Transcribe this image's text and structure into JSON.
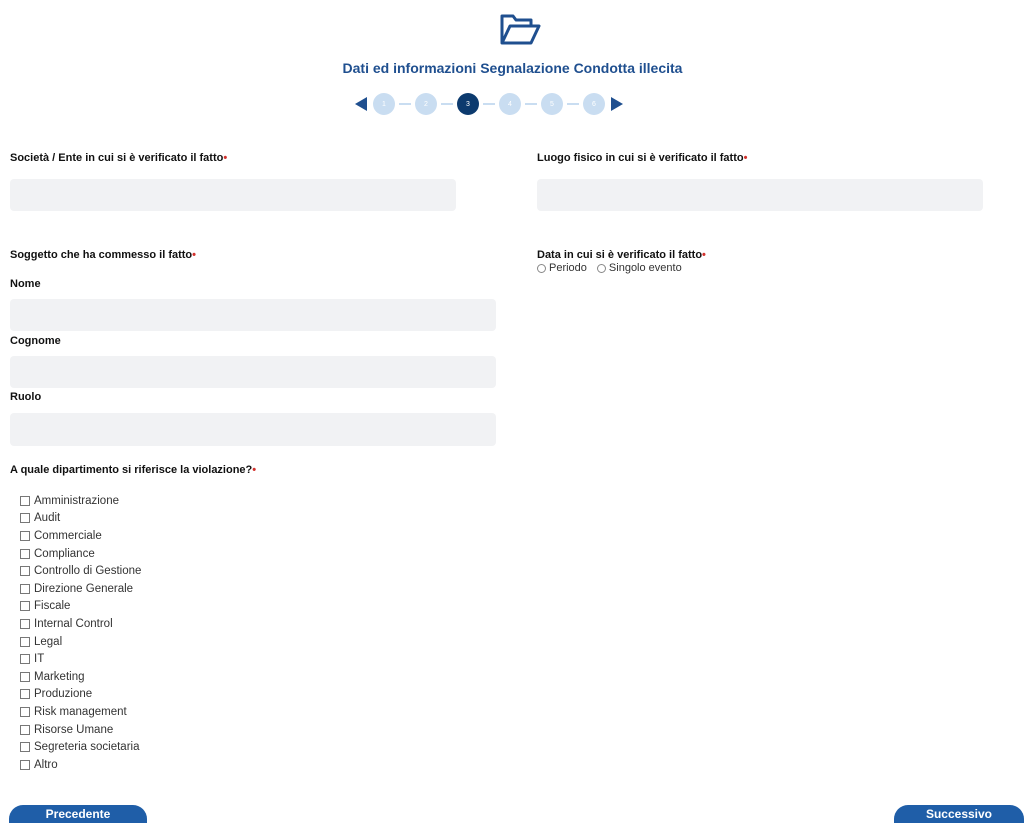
{
  "header": {
    "icon": "folder-open-icon",
    "title": "Dati ed informazioni Segnalazione Condotta illecita"
  },
  "stepper": {
    "steps": [
      "1",
      "2",
      "3",
      "4",
      "5",
      "6"
    ],
    "current": 3,
    "prev_icon": "arrow-left-icon",
    "next_icon": "arrow-right-icon"
  },
  "fields": {
    "societa": {
      "label": "Società / Ente in cui si è verificato il fatto",
      "value": ""
    },
    "luogo": {
      "label": "Luogo fisico in cui si è verificato il fatto",
      "value": ""
    },
    "soggetto": {
      "label": "Soggetto che ha commesso il fatto"
    },
    "nome": {
      "label": "Nome",
      "value": ""
    },
    "cognome": {
      "label": "Cognome",
      "value": ""
    },
    "ruolo": {
      "label": "Ruolo",
      "value": ""
    },
    "data": {
      "label": "Data in cui si è verificato il fatto",
      "options": [
        "Periodo",
        "Singolo evento"
      ]
    },
    "dipartimento": {
      "label": "A quale dipartimento si riferisce la violazione?",
      "options": [
        "Amministrazione",
        "Audit",
        "Commerciale",
        "Compliance",
        "Controllo di Gestione",
        "Direzione Generale",
        "Fiscale",
        "Internal Control",
        "Legal",
        "IT",
        "Marketing",
        "Produzione",
        "Risk management",
        "Risorse Umane",
        "Segreteria societaria",
        "Altro"
      ]
    },
    "required_marker": "•"
  },
  "buttons": {
    "prev": "Precedente",
    "next": "Successivo"
  },
  "colors": {
    "accent": "#1f4f8f",
    "button": "#1f5ea8",
    "step_inactive": "#c9ddf1",
    "step_active": "#0c3a6e",
    "required": "#d2322d",
    "field_bg": "#f1f2f4"
  }
}
